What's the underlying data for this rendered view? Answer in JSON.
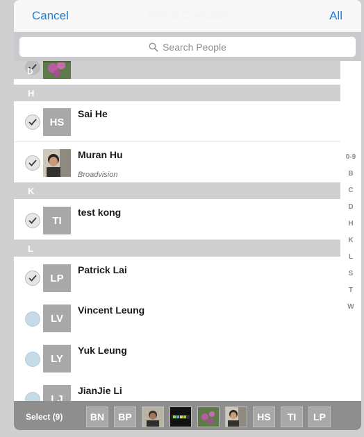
{
  "nav": {
    "cancel_label": "Cancel",
    "title": "Select Contacts",
    "all_label": "All"
  },
  "search": {
    "placeholder": "Search People"
  },
  "list": {
    "partial_row_letter": "D",
    "sections": [
      {
        "letter": "H"
      },
      {
        "letter": "K"
      },
      {
        "letter": "L"
      }
    ],
    "contacts": [
      {
        "initials": "HS",
        "name": "Sai He",
        "subtitle": "",
        "selected": true
      },
      {
        "initials": "",
        "name": "Muran Hu",
        "subtitle": "Broadvision",
        "selected": true,
        "photo": "portrait-photo"
      },
      {
        "initials": "TI",
        "name": "test kong",
        "subtitle": "",
        "selected": true
      },
      {
        "initials": "LP",
        "name": "Patrick Lai",
        "subtitle": "",
        "selected": true
      },
      {
        "initials": "LV",
        "name": "Vincent Leung",
        "subtitle": "",
        "selected": false
      },
      {
        "initials": "LY",
        "name": "Yuk Leung",
        "subtitle": "",
        "selected": false
      },
      {
        "initials": "LJ",
        "name": "JianJie Li",
        "subtitle": "",
        "selected": false
      }
    ]
  },
  "index": [
    "0-9",
    "B",
    "C",
    "D",
    "H",
    "K",
    "L",
    "S",
    "T",
    "W"
  ],
  "bottom": {
    "select_label": "Select (9)",
    "chips": [
      {
        "label": "BN",
        "kind": "initials"
      },
      {
        "label": "BP",
        "kind": "initials"
      },
      {
        "label": "",
        "kind": "person-photo"
      },
      {
        "label": "",
        "kind": "logo-photo"
      },
      {
        "label": "",
        "kind": "flower-photo"
      },
      {
        "label": "",
        "kind": "portrait-photo"
      },
      {
        "label": "HS",
        "kind": "initials"
      },
      {
        "label": "TI",
        "kind": "initials"
      },
      {
        "label": "LP",
        "kind": "initials"
      }
    ]
  },
  "colors": {
    "accent": "#1a82e2",
    "section_bg": "#cfcfcf",
    "avatar_bg": "#a8a8a8",
    "bottom_bar": "#8e8e8e"
  }
}
